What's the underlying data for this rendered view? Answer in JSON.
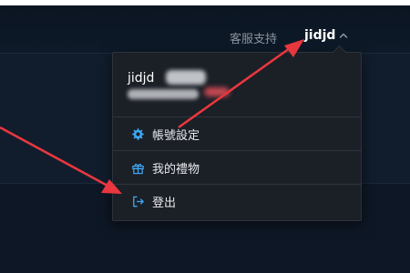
{
  "navbar": {
    "support_label": "客服支持",
    "username": "jidjd"
  },
  "dropdown": {
    "header": {
      "username": "jidjd"
    },
    "items": [
      {
        "label": "帳號設定",
        "icon": "gear-icon"
      },
      {
        "label": "我的禮物",
        "icon": "gift-icon"
      },
      {
        "label": "登出",
        "icon": "logout-icon"
      }
    ]
  },
  "colors": {
    "accent": "#3ea8f5",
    "annotation_arrow": "#e8373f",
    "dropdown_bg": "#1b1f26",
    "page_bg": "#0f1a28"
  }
}
